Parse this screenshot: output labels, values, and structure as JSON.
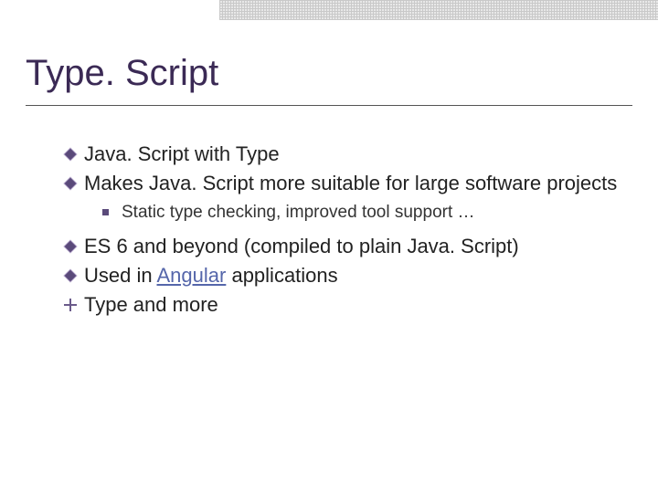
{
  "title": "Type. Script",
  "bullets": [
    {
      "kind": "diamond",
      "text": "Java. Script with Type"
    },
    {
      "kind": "diamond",
      "text": "Makes Java. Script more suitable for large software projects",
      "sub": [
        "Static type checking, improved tool support …"
      ]
    },
    {
      "kind": "diamond",
      "text": "ES 6 and beyond (compiled to plain Java. Script)"
    },
    {
      "kind": "diamond",
      "text_pre": "Used in ",
      "link": "Angular",
      "text_post": " applications"
    },
    {
      "kind": "plus",
      "text": "Type and more"
    }
  ]
}
